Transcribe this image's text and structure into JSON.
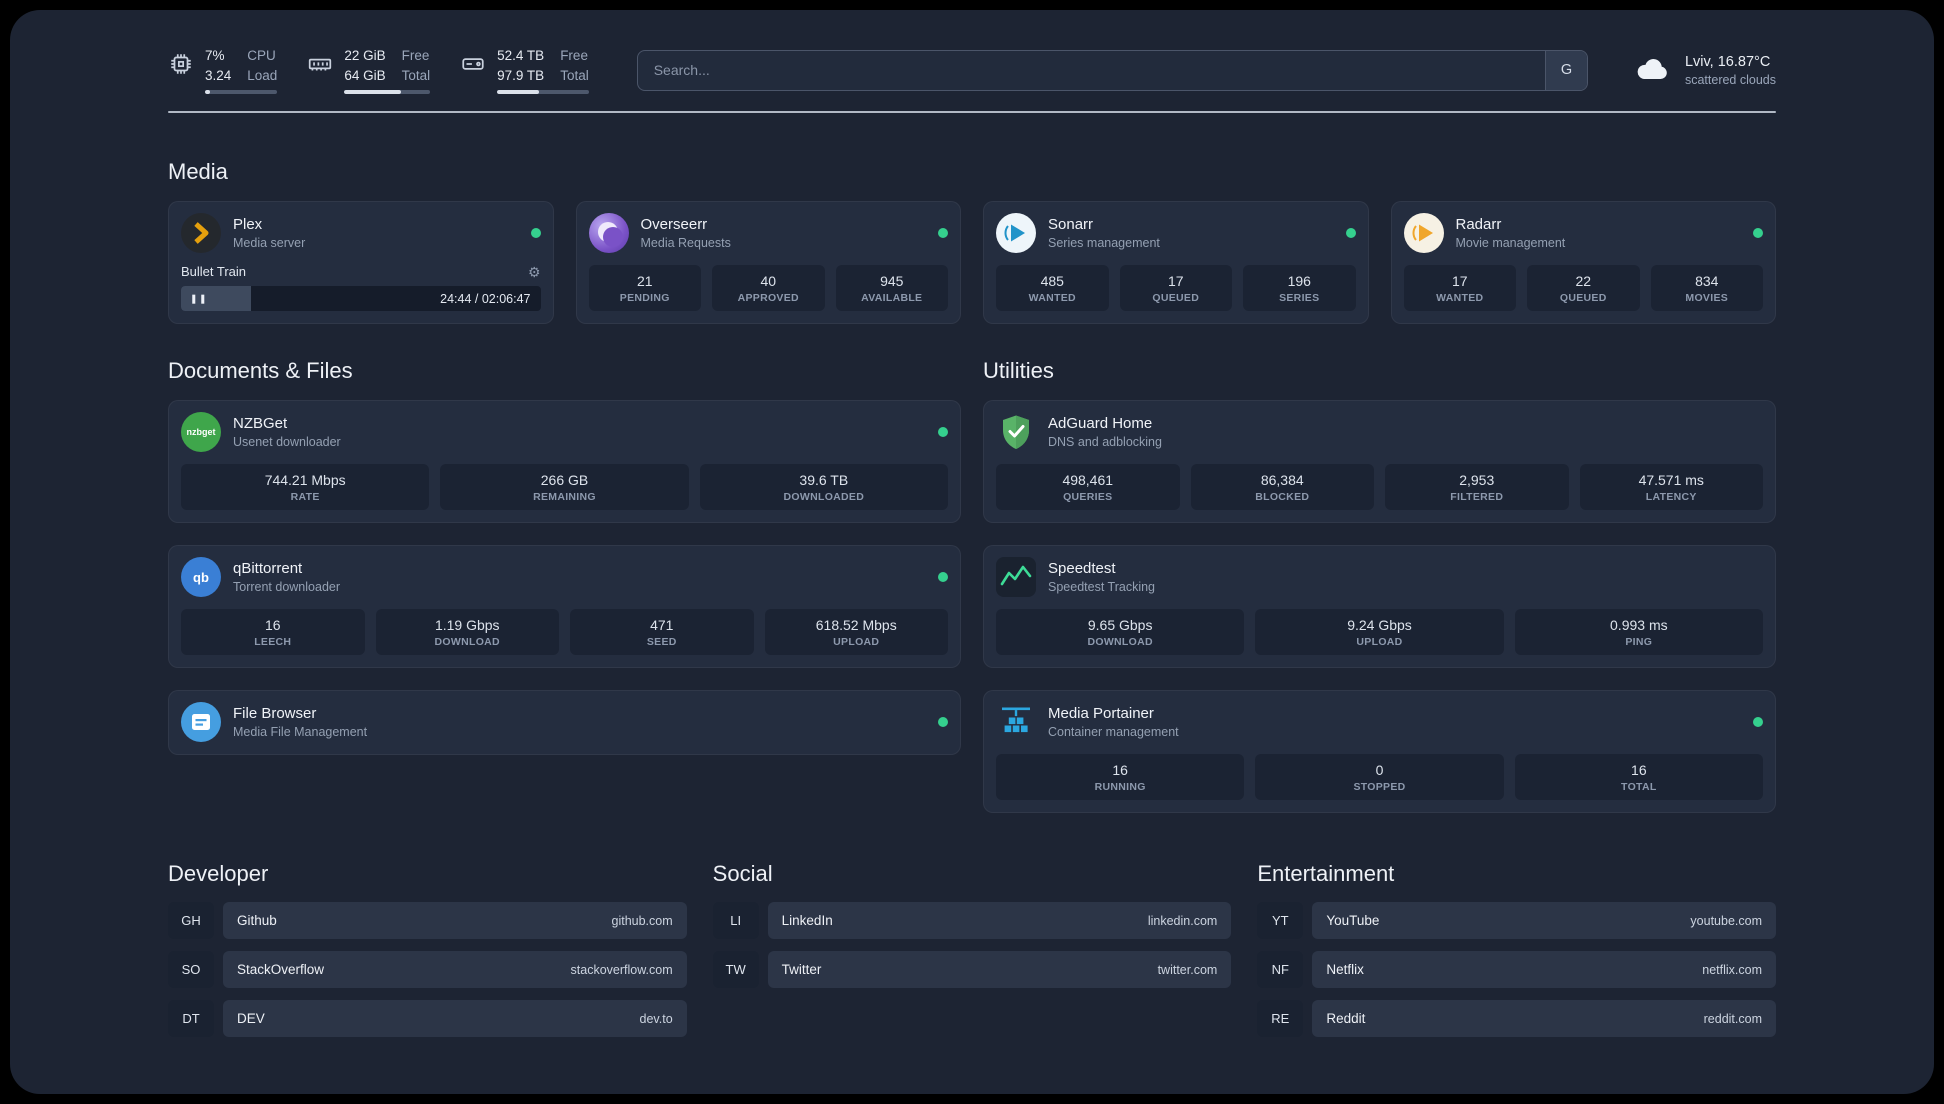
{
  "colors": {
    "background": "#1d2433",
    "card": "#242d3f",
    "stat_box": "#1b2333",
    "status_green": "#35d08e",
    "plex_amber": "#e5a00d",
    "adguard_green": "#59b368",
    "portainer_blue": "#2ba7e0",
    "speedtest_green": "#3ddc97"
  },
  "topbar": {
    "cpu": {
      "value_top": "7%",
      "value_bottom": "3.24",
      "label_top": "CPU",
      "label_bottom": "Load",
      "bar_percent": 7
    },
    "memory": {
      "value_top": "22 GiB",
      "value_bottom": "64 GiB",
      "label_top": "Free",
      "label_bottom": "Total",
      "bar_percent": 66
    },
    "disk": {
      "value_top": "52.4 TB",
      "value_bottom": "97.9 TB",
      "label_top": "Free",
      "label_bottom": "Total",
      "bar_percent": 46
    },
    "search": {
      "placeholder": "Search...",
      "provider": "G"
    },
    "weather": {
      "location": "Lviv, 16.87°C",
      "condition": "scattered clouds"
    }
  },
  "sections": {
    "media": {
      "title": "Media",
      "plex": {
        "name": "Plex",
        "desc": "Media server",
        "now_playing": {
          "title": "Bullet Train",
          "time": "24:44 / 02:06:47",
          "progress_percent": 19.5
        }
      },
      "overseerr": {
        "name": "Overseerr",
        "desc": "Media Requests",
        "stats": [
          {
            "value": "21",
            "label": "PENDING"
          },
          {
            "value": "40",
            "label": "APPROVED"
          },
          {
            "value": "945",
            "label": "AVAILABLE"
          }
        ]
      },
      "sonarr": {
        "name": "Sonarr",
        "desc": "Series management",
        "stats": [
          {
            "value": "485",
            "label": "WANTED"
          },
          {
            "value": "17",
            "label": "QUEUED"
          },
          {
            "value": "196",
            "label": "SERIES"
          }
        ]
      },
      "radarr": {
        "name": "Radarr",
        "desc": "Movie management",
        "stats": [
          {
            "value": "17",
            "label": "WANTED"
          },
          {
            "value": "22",
            "label": "QUEUED"
          },
          {
            "value": "834",
            "label": "MOVIES"
          }
        ]
      }
    },
    "documents": {
      "title": "Documents & Files",
      "nzbget": {
        "name": "NZBGet",
        "desc": "Usenet downloader",
        "icon_text": "nzbget",
        "stats": [
          {
            "value": "744.21 Mbps",
            "label": "RATE"
          },
          {
            "value": "266 GB",
            "label": "REMAINING"
          },
          {
            "value": "39.6 TB",
            "label": "DOWNLOADED"
          }
        ]
      },
      "qbittorrent": {
        "name": "qBittorrent",
        "desc": "Torrent downloader",
        "icon_text": "qb",
        "stats": [
          {
            "value": "16",
            "label": "LEECH"
          },
          {
            "value": "1.19 Gbps",
            "label": "DOWNLOAD"
          },
          {
            "value": "471",
            "label": "SEED"
          },
          {
            "value": "618.52 Mbps",
            "label": "UPLOAD"
          }
        ]
      },
      "filebrowser": {
        "name": "File Browser",
        "desc": "Media File Management"
      }
    },
    "utilities": {
      "title": "Utilities",
      "adguard": {
        "name": "AdGuard Home",
        "desc": "DNS and adblocking",
        "stats": [
          {
            "value": "498,461",
            "label": "QUERIES"
          },
          {
            "value": "86,384",
            "label": "BLOCKED"
          },
          {
            "value": "2,953",
            "label": "FILTERED"
          },
          {
            "value": "47.571 ms",
            "label": "LATENCY"
          }
        ]
      },
      "speedtest": {
        "name": "Speedtest",
        "desc": "Speedtest Tracking",
        "stats": [
          {
            "value": "9.65 Gbps",
            "label": "DOWNLOAD"
          },
          {
            "value": "9.24 Gbps",
            "label": "UPLOAD"
          },
          {
            "value": "0.993 ms",
            "label": "PING"
          }
        ]
      },
      "portainer": {
        "name": "Media Portainer",
        "desc": "Container management",
        "stats": [
          {
            "value": "16",
            "label": "RUNNING"
          },
          {
            "value": "0",
            "label": "STOPPED"
          },
          {
            "value": "16",
            "label": "TOTAL"
          }
        ]
      }
    }
  },
  "bookmarks": [
    {
      "title": "Developer",
      "items": [
        {
          "abbr": "GH",
          "name": "Github",
          "domain": "github.com"
        },
        {
          "abbr": "SO",
          "name": "StackOverflow",
          "domain": "stackoverflow.com"
        },
        {
          "abbr": "DT",
          "name": "DEV",
          "domain": "dev.to"
        }
      ]
    },
    {
      "title": "Social",
      "items": [
        {
          "abbr": "LI",
          "name": "LinkedIn",
          "domain": "linkedin.com"
        },
        {
          "abbr": "TW",
          "name": "Twitter",
          "domain": "twitter.com"
        }
      ]
    },
    {
      "title": "Entertainment",
      "items": [
        {
          "abbr": "YT",
          "name": "YouTube",
          "domain": "youtube.com"
        },
        {
          "abbr": "NF",
          "name": "Netflix",
          "domain": "netflix.com"
        },
        {
          "abbr": "RE",
          "name": "Reddit",
          "domain": "reddit.com"
        }
      ]
    }
  ]
}
